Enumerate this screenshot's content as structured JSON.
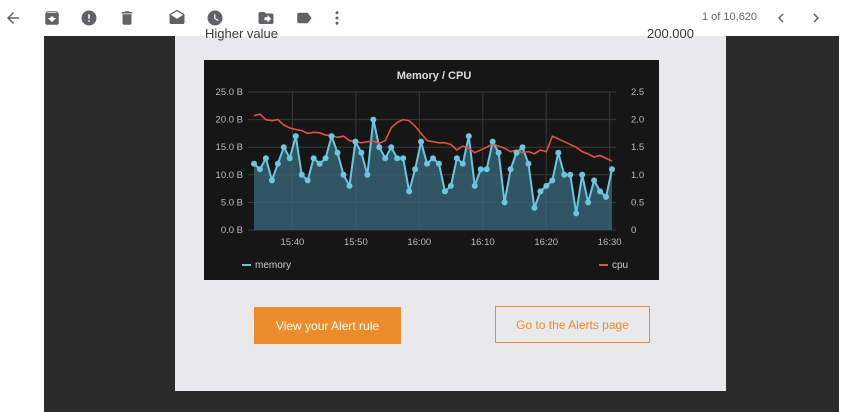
{
  "toolbar": {
    "icons": [
      "back-arrow-icon",
      "archive-icon",
      "report-spam-icon",
      "delete-icon",
      "mark-unread-icon",
      "snooze-icon",
      "move-to-icon",
      "label-icon",
      "more-vert-icon",
      "chevron-left-icon",
      "chevron-right-icon"
    ],
    "page_count": "1 of 10,620"
  },
  "email": {
    "partial_row_label": "Higher value",
    "partial_row_value": "200.000",
    "primary_button": "View your Alert rule",
    "secondary_button": "Go to the Alerts page",
    "accent_color": "#ec8c2b"
  },
  "chart_data": {
    "type": "line",
    "title": "Memory / CPU",
    "x_ticks": [
      "15:40",
      "15:50",
      "16:00",
      "16:10",
      "16:20",
      "16:30"
    ],
    "x_range": [
      "15:33",
      "16:31"
    ],
    "y_left_ticks": [
      "25.0 B",
      "20.0 B",
      "15.0 B",
      "10.0 B",
      "5.0 B",
      "0.0 B"
    ],
    "y_left_range": [
      0,
      25
    ],
    "y_right_ticks": [
      "2.5",
      "2.0",
      "1.5",
      "1.0",
      "0.5",
      "0"
    ],
    "y_right_range": [
      0,
      2.5
    ],
    "grid": true,
    "legend_placement": "bottom",
    "series": [
      {
        "name": "memory",
        "color": "#6ac7e2",
        "axis": "left",
        "x_minutes": [
          0,
          1,
          2,
          3,
          4,
          5,
          6,
          7,
          8,
          9,
          10,
          11,
          12,
          13,
          14,
          15,
          16,
          17,
          18,
          19,
          20,
          21,
          22,
          23,
          24,
          25,
          26,
          27,
          28,
          29,
          30,
          31,
          32,
          33,
          34,
          35,
          36,
          37,
          38,
          39,
          40,
          41,
          42,
          43,
          44,
          45,
          46,
          47,
          48,
          49,
          50,
          51,
          52,
          53,
          54,
          55,
          56,
          57
        ],
        "values": [
          12,
          11,
          13,
          9,
          12,
          15,
          13,
          17,
          10,
          9,
          13,
          12,
          13,
          17,
          14,
          10,
          8,
          16,
          14,
          10,
          20,
          15,
          13,
          15,
          13,
          13,
          7,
          11,
          16,
          12,
          13,
          12,
          7,
          8,
          13,
          12,
          17,
          8,
          11,
          11,
          16,
          14,
          5,
          11,
          14,
          15,
          12,
          4,
          7,
          8,
          9,
          14,
          10,
          10,
          3,
          10,
          5,
          9,
          7,
          6,
          11
        ],
        "fill": true
      },
      {
        "name": "cpu",
        "color": "#e2533b",
        "axis": "right",
        "x_minutes": [
          0,
          1,
          2,
          3,
          4,
          5,
          6,
          7,
          8,
          9,
          10,
          11,
          12,
          13,
          14,
          15,
          16,
          17,
          18,
          19,
          20,
          21,
          22,
          23,
          24,
          25,
          26,
          27,
          28,
          29,
          30,
          31,
          32,
          33,
          34,
          35,
          36,
          37,
          38,
          39,
          40,
          41,
          42,
          43,
          44,
          45,
          46,
          47,
          48,
          49,
          50,
          51,
          52,
          53,
          54,
          55,
          56,
          57
        ],
        "values": [
          2.07,
          2.1,
          2.0,
          1.98,
          2.0,
          1.9,
          1.85,
          1.82,
          1.8,
          1.75,
          1.77,
          1.76,
          1.72,
          1.71,
          1.68,
          1.7,
          1.62,
          1.6,
          1.58,
          1.6,
          1.61,
          1.57,
          1.62,
          1.85,
          1.95,
          2.0,
          1.98,
          1.88,
          1.75,
          1.62,
          1.6,
          1.58,
          1.58,
          1.55,
          1.45,
          1.52,
          1.48,
          1.4,
          1.45,
          1.5,
          1.56,
          1.52,
          1.48,
          1.42,
          1.45,
          1.4,
          1.42,
          1.38,
          1.45,
          1.42,
          1.7,
          1.65,
          1.6,
          1.55,
          1.5,
          1.42,
          1.38,
          1.32,
          1.35,
          1.3,
          1.25
        ]
      }
    ]
  }
}
